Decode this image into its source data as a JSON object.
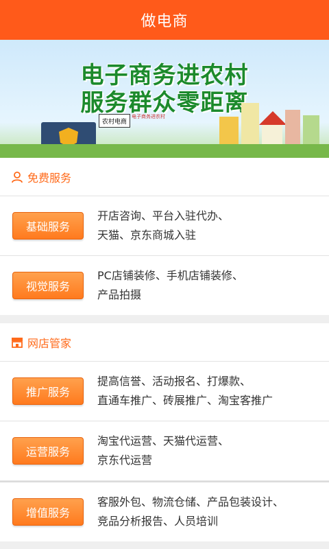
{
  "header": {
    "title": "做电商"
  },
  "banner": {
    "headline_line1": "电子商务进农村",
    "headline_line2": "服务群众零距离",
    "badge": "农村电商",
    "sub_text": "电子商务进农村"
  },
  "sections": [
    {
      "title": "免费服务",
      "icon": "user-icon",
      "items": [
        {
          "button": "基础服务",
          "line1": "开店咨询、平台入驻代办、",
          "line2": "天猫、京东商城入驻"
        },
        {
          "button": "视觉服务",
          "line1": "PC店铺装修、手机店铺装修、",
          "line2": "产品拍摄"
        }
      ]
    },
    {
      "title": "网店管家",
      "icon": "store-icon",
      "items": [
        {
          "button": "推广服务",
          "line1": "提高信誉、活动报名、打爆款、",
          "line2": "直通车推广、砖展推广、淘宝客推广"
        },
        {
          "button": "运营服务",
          "line1": "淘宝代运营、天猫代运营、",
          "line2": "京东代运营"
        },
        {
          "button": "增值服务",
          "line1": "客服外包、物流仓储、产品包装设计、",
          "line2": "竞品分析报告、人员培训"
        }
      ]
    }
  ],
  "colors": {
    "accent": "#ff5a1a",
    "button": "#ff7a1e",
    "headline": "#1c8a2c"
  }
}
